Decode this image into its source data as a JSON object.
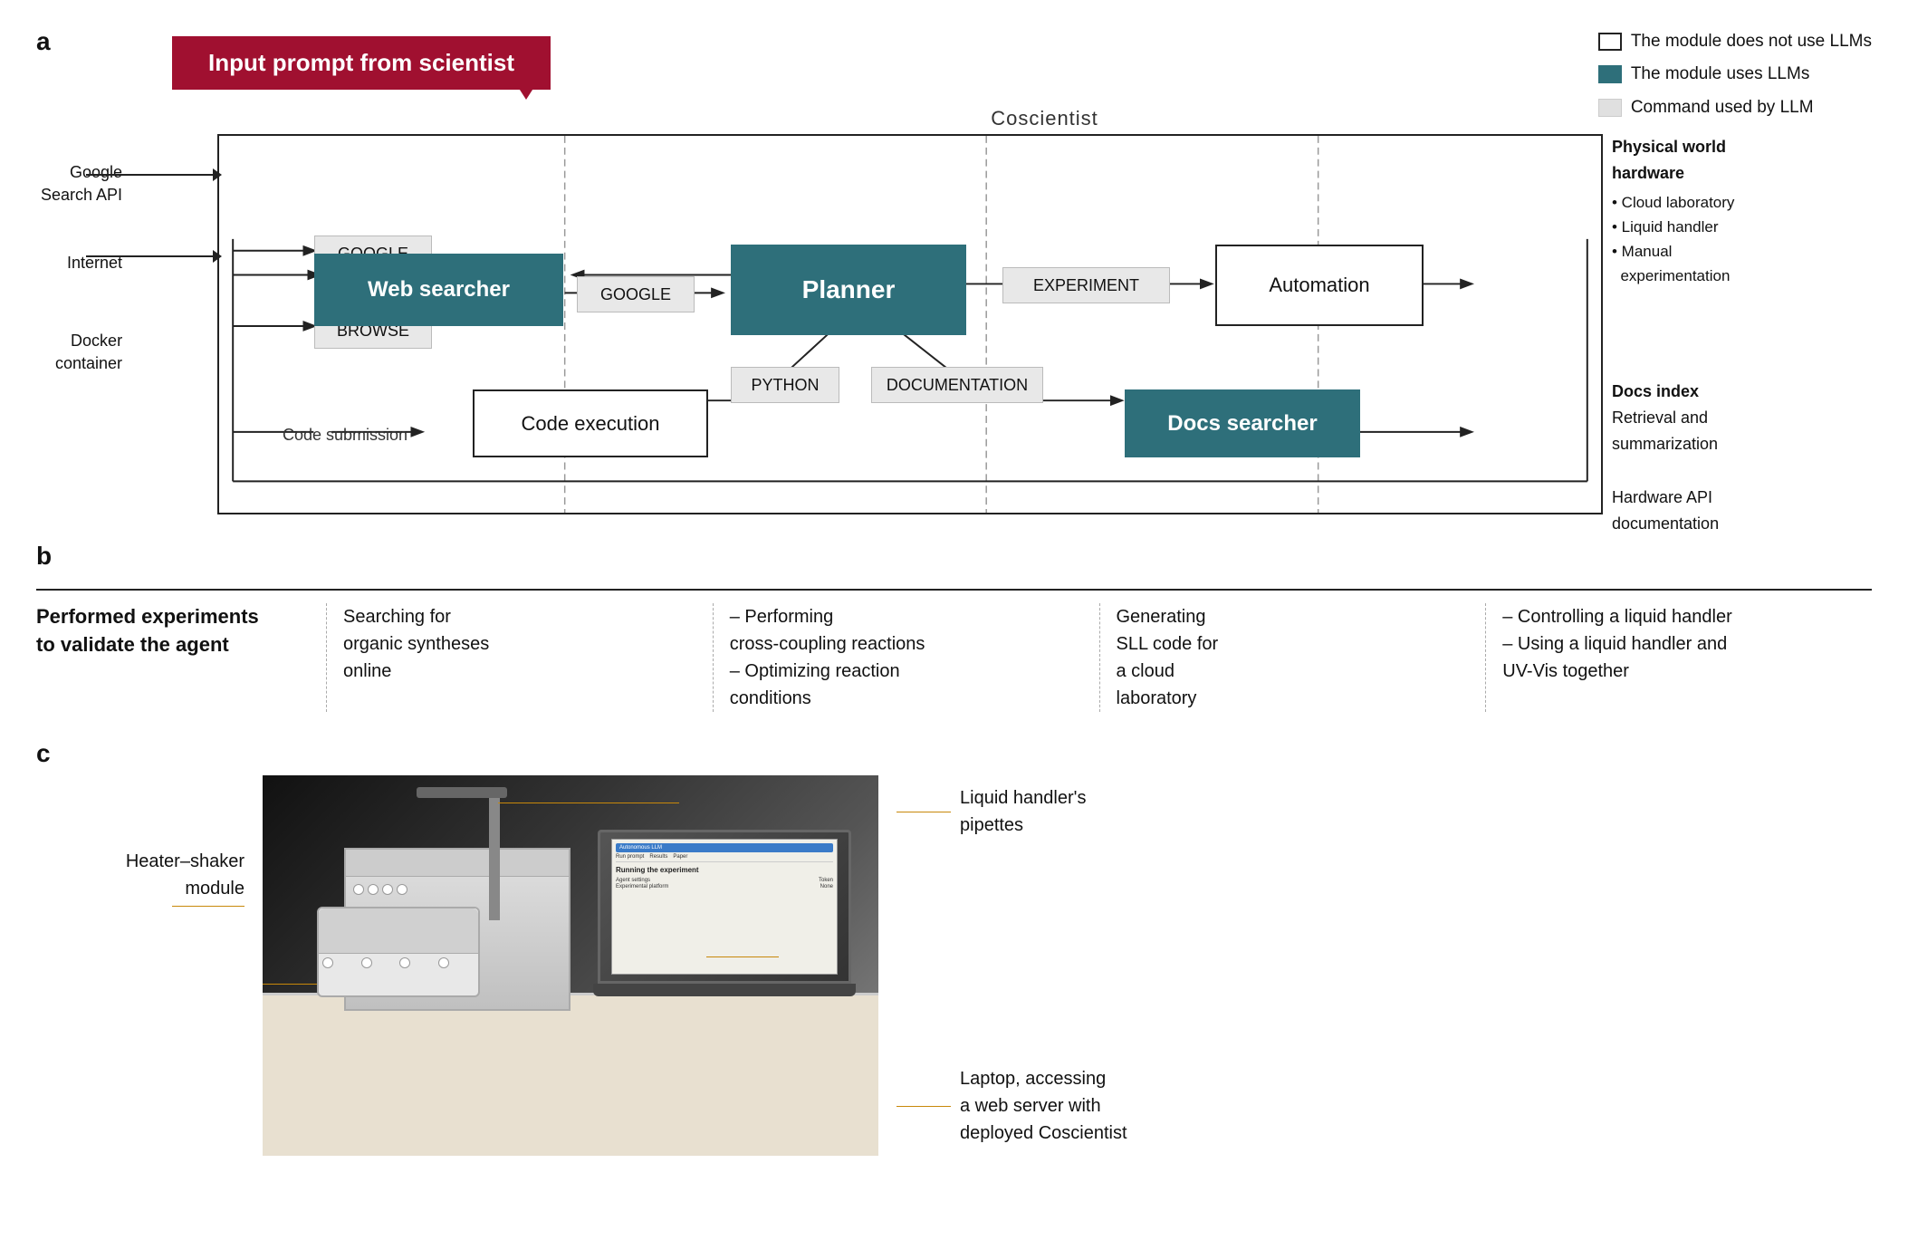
{
  "legend": {
    "item1": "The module does not use LLMs",
    "item2": "The module uses LLMs",
    "item3": "Command used by LLM"
  },
  "section_a": {
    "label": "a",
    "input_prompt": "Input prompt from scientist",
    "coscientist": "Coscientist",
    "web_searcher": "Web searcher",
    "planner": "Planner",
    "code_execution": "Code execution",
    "docs_searcher": "Docs searcher",
    "automation": "Automation",
    "commands": {
      "google1": "GOOGLE",
      "google2": "GOOGLE",
      "browse": "BROWSE",
      "python": "PYTHON",
      "documentation": "DOCUMENTATION",
      "experiment": "EXPERIMENT"
    },
    "left_labels": {
      "google_search": "Google\nSearch API",
      "internet": "Internet",
      "docker": "Docker\ncontainer",
      "code_submission": "Code submission"
    },
    "right_labels": {
      "physical_world": "Physical world\nhardware",
      "cloud_lab": "Cloud laboratory",
      "liquid_handler": "Liquid handler",
      "manual": "Manual\nexperimentation",
      "docs_index_title": "Docs index",
      "docs_index_desc": "Retrieval and\nsummarization",
      "hardware_api": "Hardware API\ndocumentation"
    }
  },
  "section_b": {
    "label": "b",
    "title": "Performed experiments\nto validate the agent",
    "columns": [
      "Searching for\norganic syntheses\nonline",
      "– Performing\ncross-coupling reactions\n– Optimizing reaction\nconditions",
      "Generating\nSLL code for\na cloud\nlaboratory",
      "– Controlling a liquid handler\n– Using a liquid handler and\nUV-Vis together"
    ]
  },
  "section_c": {
    "label": "c",
    "annotations": {
      "heater_shaker": "Heater–shaker\nmodule",
      "pipettes": "Liquid handler's\npipettes",
      "laptop": "Laptop, accessing\na web server with\ndeployed Coscientist"
    },
    "laptop_screen": {
      "tab": "Autonomous LLM",
      "menu1": "Run prompt",
      "menu2": "Results",
      "menu3": "Paper",
      "running_text": "Running the experiment",
      "agent_settings": "Agent settings",
      "token_label": "Token",
      "platform_label": "Experimental platform",
      "token_value": "None"
    }
  }
}
